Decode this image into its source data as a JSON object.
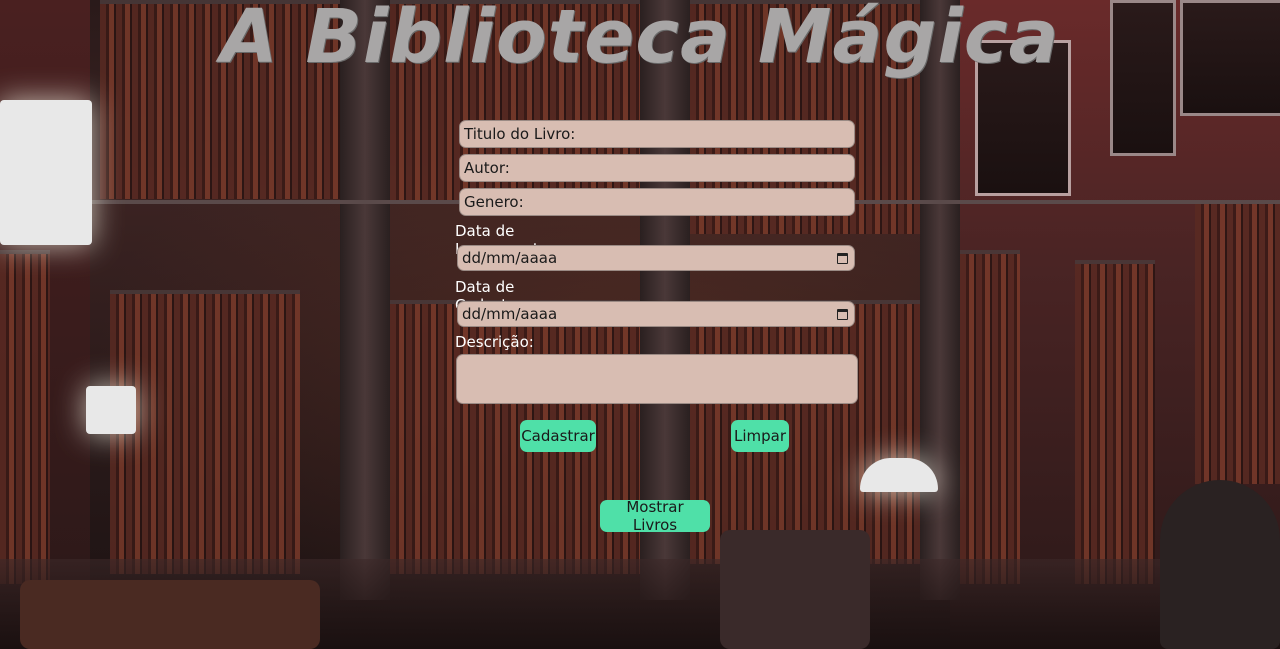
{
  "title": "A Biblioteca Mágica",
  "form": {
    "titulo_placeholder": "Titulo do Livro:",
    "autor_placeholder": "Autor:",
    "genero_placeholder": "Genero:",
    "lancamento_label": "Data de Lançamento:",
    "lancamento_placeholder": "dd/mm/aaaa",
    "cadastro_label": "Data de Cadastro:",
    "cadastro_placeholder": "dd/mm/aaaa",
    "descricao_label": "Descrição:",
    "descricao_value": ""
  },
  "buttons": {
    "cadastrar": "Cadastrar",
    "limpar": "Limpar",
    "mostrar": "Mostrar Livros"
  },
  "colors": {
    "input_bg": "#d8bdb2",
    "button_bg": "#4fe0a8",
    "title": "#a8a6a6"
  },
  "icons": {
    "calendar": "calendar-icon"
  }
}
